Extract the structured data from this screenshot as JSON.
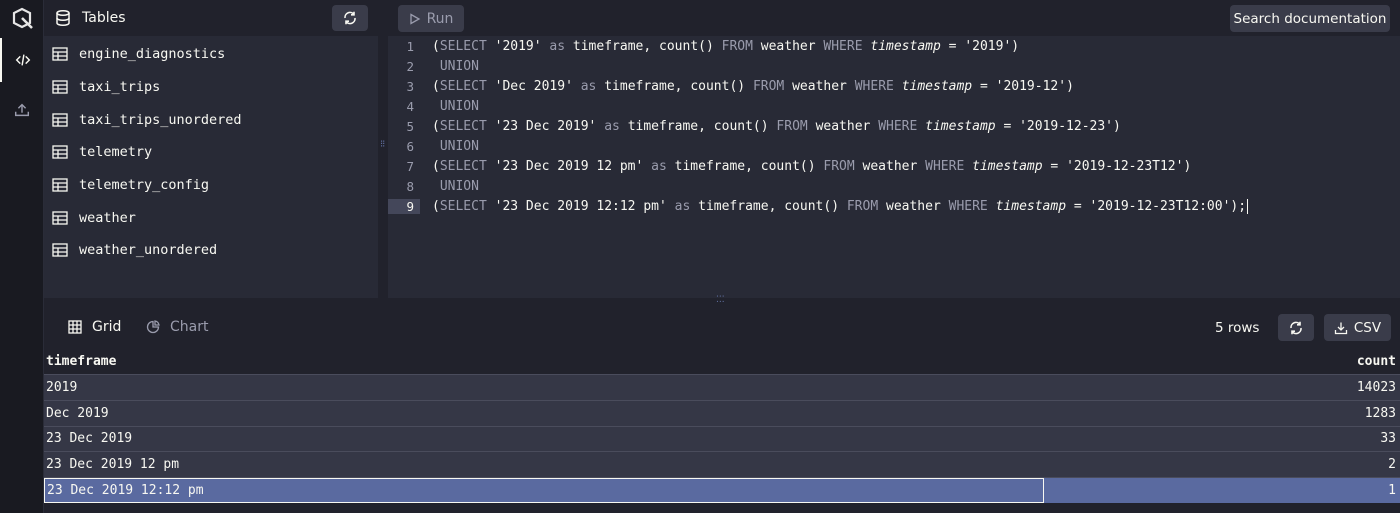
{
  "tables_panel": {
    "title": "Tables",
    "tables": [
      "engine_diagnostics",
      "taxi_trips",
      "taxi_trips_unordered",
      "telemetry",
      "telemetry_config",
      "weather",
      "weather_unordered"
    ]
  },
  "toolbar": {
    "run_label": "Run",
    "search_label": "Search documentation"
  },
  "editor": {
    "lines": [
      {
        "n": "1",
        "kind": "select",
        "label": "'2019'",
        "filter": "'2019'"
      },
      {
        "n": "2",
        "kind": "union",
        "text": "UNION"
      },
      {
        "n": "3",
        "kind": "select",
        "label": "'Dec 2019'",
        "filter": "'2019-12'"
      },
      {
        "n": "4",
        "kind": "union",
        "text": "UNION"
      },
      {
        "n": "5",
        "kind": "select",
        "label": "'23 Dec 2019'",
        "filter": "'2019-12-23'"
      },
      {
        "n": "6",
        "kind": "union",
        "text": "UNION"
      },
      {
        "n": "7",
        "kind": "select",
        "label": "'23 Dec 2019 12 pm'",
        "filter": "'2019-12-23T12'"
      },
      {
        "n": "8",
        "kind": "union",
        "text": "UNION"
      },
      {
        "n": "9",
        "kind": "select",
        "label": "'23 Dec 2019 12:12 pm'",
        "filter": "'2019-12-23T12:00'",
        "end": ");"
      }
    ],
    "tokens": {
      "open": "(",
      "select": "SELECT",
      "as": "as",
      "timeframe": "timeframe,",
      "count": "count()",
      "from": "FROM",
      "table": "weather",
      "where": "WHERE",
      "column": "timestamp",
      "eq": "=",
      "close": ")"
    }
  },
  "results": {
    "tabs": [
      "Grid",
      "Chart"
    ],
    "rows_label": "5 rows",
    "csv_label": "CSV",
    "columns": [
      "timeframe",
      "count"
    ],
    "rows": [
      {
        "timeframe": "2019",
        "count": "14023"
      },
      {
        "timeframe": "Dec 2019",
        "count": "1283"
      },
      {
        "timeframe": "23 Dec 2019",
        "count": "33"
      },
      {
        "timeframe": "23 Dec 2019 12 pm",
        "count": "2"
      },
      {
        "timeframe": "23 Dec 2019 12:12 pm",
        "count": "1",
        "selected": true
      }
    ]
  },
  "colors": {
    "background": "#21222c",
    "panel": "#282a36",
    "selection": "#5a6aa0"
  }
}
